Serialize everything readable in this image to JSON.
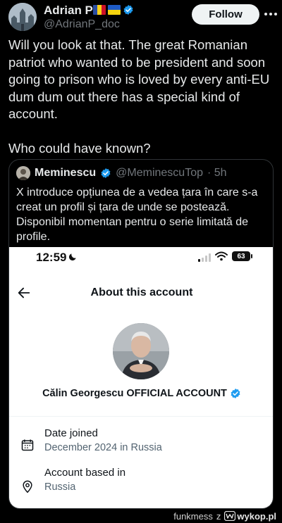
{
  "tweet": {
    "display_name": "Adrian P",
    "handle": "@AdrianP_doc",
    "follow_label": "Follow",
    "text_paragraph_1": "Will you look at that. The great Romanian patriot who wanted to be president and soon going to prison who is loved by every anti-EU dum dum out there has a special kind of account.",
    "text_paragraph_2": "Who could have known?"
  },
  "quote": {
    "name": "Meminescu",
    "handle": "@MeminescuTop",
    "time": "· 5h",
    "text": "X introduce opțiunea de a vedea țara în care s-a creat un profil și țara de unde se postează. Disponibil momentan pentru o serie limitată de profile."
  },
  "phone": {
    "time": "12:59",
    "battery": "63",
    "page_title": "About this account",
    "account_name": "Călin Georgescu OFFICIAL ACCOUNT",
    "rows": [
      {
        "label": "Date joined",
        "value": "December 2024 in Russia",
        "icon": "calendar-icon"
      },
      {
        "label": "Account based in",
        "value": "Russia",
        "icon": "location-pin-icon"
      }
    ]
  },
  "watermark": {
    "user": "funkmess",
    "prefix": "z",
    "site": "wykop.pl"
  },
  "colors": {
    "background": "#000000",
    "text": "#e7e9ea",
    "secondary": "#71767b",
    "verified": "#1d9bf0",
    "follow_bg": "#eff3f4"
  }
}
